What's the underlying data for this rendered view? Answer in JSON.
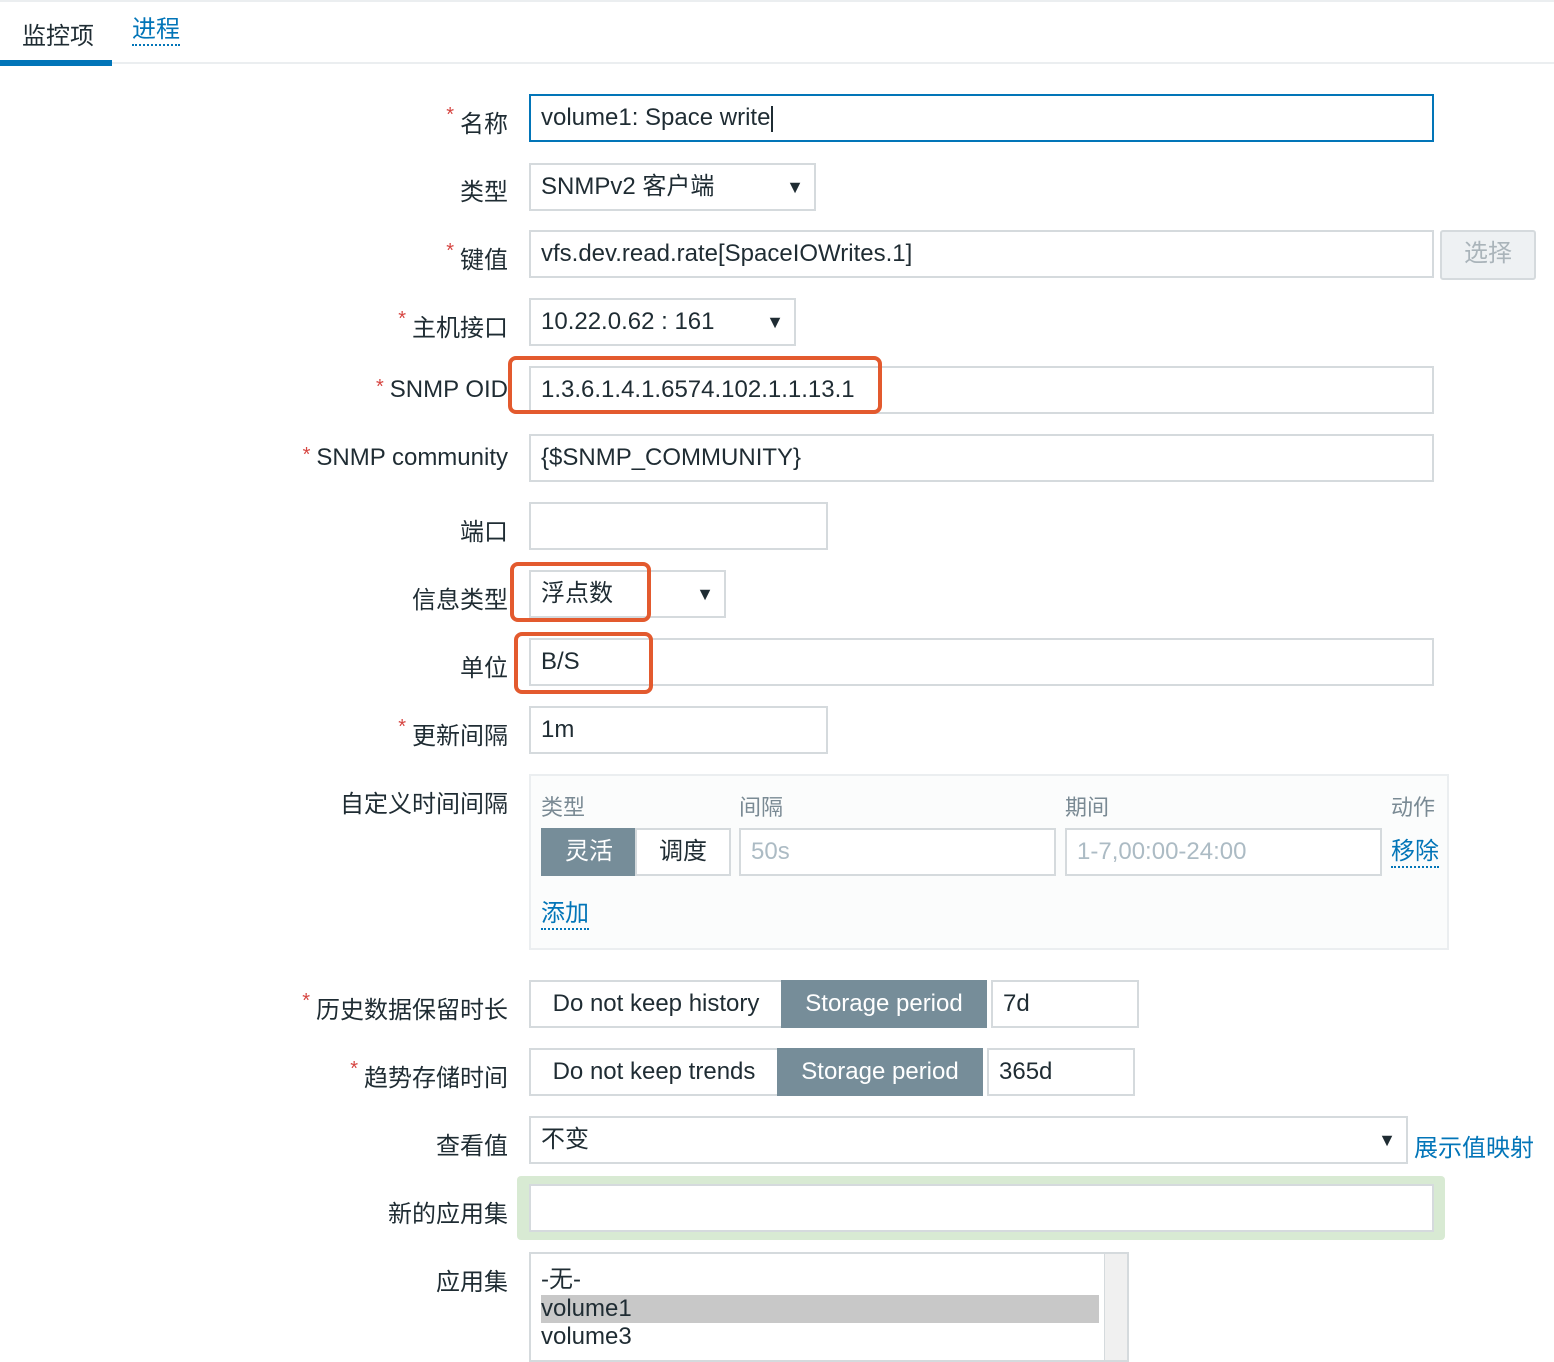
{
  "tabs": [
    {
      "label": "监控项"
    },
    {
      "label": "进程"
    }
  ],
  "form": {
    "name": {
      "label": "名称",
      "value": "volume1: Space write"
    },
    "type": {
      "label": "类型",
      "value": "SNMPv2 客户端"
    },
    "key": {
      "label": "键值",
      "value": "vfs.dev.read.rate[SpaceIOWrites.1]",
      "button": "选择"
    },
    "host_interface": {
      "label": "主机接口",
      "value": "10.22.0.62 : 161"
    },
    "snmp_oid": {
      "label": "SNMP OID",
      "value": "1.3.6.1.4.1.6574.102.1.1.13.1"
    },
    "snmp_community": {
      "label": "SNMP community",
      "value": "{$SNMP_COMMUNITY}"
    },
    "port": {
      "label": "端口",
      "value": ""
    },
    "info_type": {
      "label": "信息类型",
      "value": "浮点数"
    },
    "units": {
      "label": "单位",
      "value": "B/S"
    },
    "update_interval": {
      "label": "更新间隔",
      "value": "1m"
    },
    "custom_intervals": {
      "label": "自定义时间间隔",
      "headers": {
        "type": "类型",
        "interval": "间隔",
        "period": "期间",
        "action": "动作"
      },
      "row": {
        "flexible": "灵活",
        "scheduling": "调度",
        "interval": "50s",
        "period": "1-7,00:00-24:00",
        "remove": "移除"
      },
      "add": "添加"
    },
    "history": {
      "label": "历史数据保留时长",
      "opt_off": "Do not keep history",
      "opt_on": "Storage period",
      "value": "7d"
    },
    "trends": {
      "label": "趋势存储时间",
      "opt_off": "Do not keep trends",
      "opt_on": "Storage period",
      "value": "365d"
    },
    "show_value": {
      "label": "查看值",
      "value": "不变",
      "link": "展示值映射"
    },
    "new_application": {
      "label": "新的应用集",
      "value": ""
    },
    "applications": {
      "label": "应用集",
      "items": [
        "-无-",
        "volume1",
        "volume3"
      ]
    }
  },
  "colors": {
    "accent": "#0275b8",
    "highlight": "#e35a2e",
    "segment_on": "#768d99",
    "required": "#d64541"
  }
}
